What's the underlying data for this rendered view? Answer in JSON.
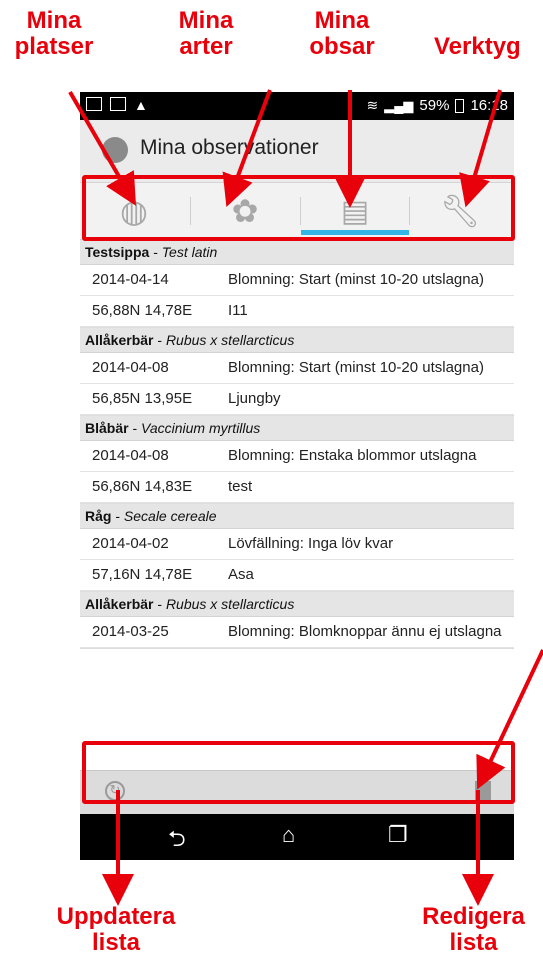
{
  "callouts": {
    "places": "Mina\nplatser",
    "species": "Mina\narter",
    "obs": "Mina\nobsar",
    "tools": "Verktyg",
    "refresh": "Uppdatera\nlista",
    "edit": "Redigera\nlista"
  },
  "status": {
    "battery": "59%",
    "time": "16:18"
  },
  "actionbar": {
    "title": "Mina observationer"
  },
  "tabs": [
    {
      "name": "places",
      "icon": "globe-icon"
    },
    {
      "name": "species",
      "icon": "flower-icon"
    },
    {
      "name": "observations",
      "icon": "document-icon",
      "selected": true
    },
    {
      "name": "tools",
      "icon": "wrench-icon"
    }
  ],
  "observations": [
    {
      "species": "Testsippa",
      "latin": "Test latin",
      "date": "2014-04-14",
      "phase": "Blomning: Start (minst 10-20 utslagna)",
      "coords": "56,88N 14,78E",
      "place": "I11"
    },
    {
      "species": "Allåkerbär",
      "latin": "Rubus x stellarcticus",
      "date": "2014-04-08",
      "phase": "Blomning: Start (minst 10-20 utslagna)",
      "coords": "56,85N 13,95E",
      "place": "Ljungby"
    },
    {
      "species": "Blåbär",
      "latin": "Vaccinium myrtillus",
      "date": "2014-04-08",
      "phase": "Blomning: Enstaka blommor utslagna",
      "coords": "56,86N 14,83E",
      "place": "test"
    },
    {
      "species": "Råg",
      "latin": "Secale cereale",
      "date": "2014-04-02",
      "phase": "Lövfällning: Inga löv kvar",
      "coords": "57,16N 14,78E",
      "place": "Asa"
    },
    {
      "species": "Allåkerbär",
      "latin": "Rubus x stellarcticus",
      "date": "2014-03-25",
      "phase": "Blomning: Blomknoppar ännu ej utslagna",
      "coords": "",
      "place": ""
    }
  ],
  "colors": {
    "annotation": "#e8000b",
    "tab_indicator": "#33b5e5"
  }
}
